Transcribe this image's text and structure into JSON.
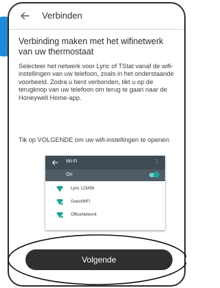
{
  "header": {
    "title": "Verbinden",
    "back_icon": "arrow-left-icon"
  },
  "content": {
    "heading": "Verbinding maken met het wifinetwerk van uw thermostaat",
    "body": "Selecteer het netwerk voor Lyric of TStat vanaf de wifi-instellingen van uw telefoon, zoals in het onderstaande voorbeeld. Zodra u bent verbonden, tikt u op de terugknop van uw telefoon om terug te gaan naar de Honeywell Home-app.",
    "instruction": "Tik op VOLGENDE om uw wifi-instellingen te openen."
  },
  "wifi_example": {
    "title": "Wi-Fi",
    "toggle_label": "On",
    "toggle_on": true,
    "menu_icon": "more-vert-icon",
    "networks": [
      {
        "name": "Lyric 123456",
        "icon": "wifi-icon"
      },
      {
        "name": "GuestWiFi",
        "icon": "wifi-lock-icon"
      },
      {
        "name": "OfficeNetwork",
        "icon": "wifi-lock-icon"
      }
    ]
  },
  "footer": {
    "next_label": "Volgende"
  },
  "colors": {
    "accent_badge": "#1f8bd6",
    "wifi_bar": "#3f4b55",
    "wifi_on_row": "#4f5c67",
    "wifi_teal": "#1aa394",
    "button": "#2f2f2f"
  }
}
